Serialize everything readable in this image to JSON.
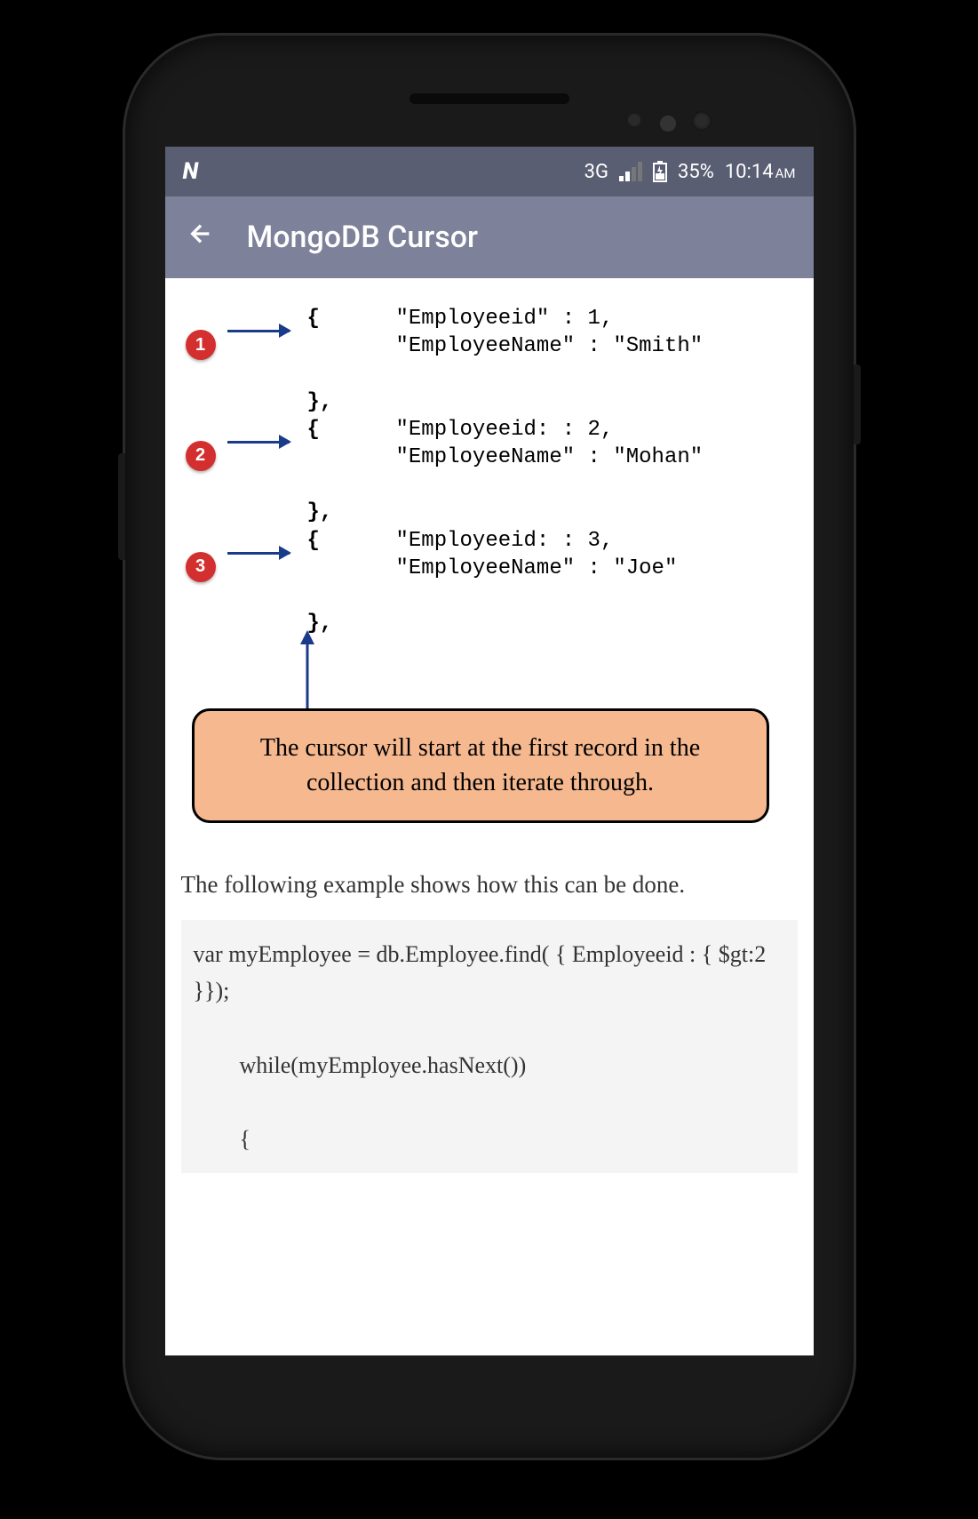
{
  "statusBar": {
    "leftIcon": "N",
    "network": "3G",
    "battery": "35%",
    "time": "10:14",
    "ampm": "AM"
  },
  "appBar": {
    "title": "MongoDB Cursor"
  },
  "diagram": {
    "rows": [
      {
        "num": "1",
        "braceOpen": "{",
        "braceClose": "},",
        "line1": "\"Employeeid\" : 1,",
        "line2": "\"EmployeeName\" : \"Smith\""
      },
      {
        "num": "2",
        "braceOpen": "{",
        "braceClose": "},",
        "line1": "\"Employeeid: : 2,",
        "line2": "\"EmployeeName\" : \"Mohan\""
      },
      {
        "num": "3",
        "braceOpen": "{",
        "braceClose": "},",
        "line1": "\"Employeeid: : 3,",
        "line2": "\"EmployeeName\" : \"Joe\""
      }
    ],
    "callout": "The cursor will start at the first record in the collection and then iterate through."
  },
  "bodyText": "The following example shows how this can be done.",
  "codeBlock": "var myEmployee = db.Employee.find( { Employeeid : { $gt:2 }});\n\n        while(myEmployee.hasNext())\n\n        {"
}
